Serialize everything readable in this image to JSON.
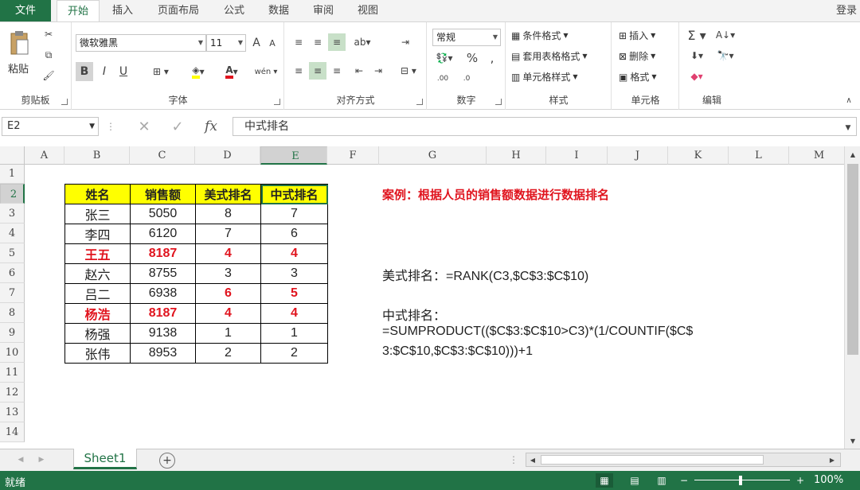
{
  "tabs": {
    "file": "文件",
    "home": "开始",
    "insert": "插入",
    "layout": "页面布局",
    "formulas": "公式",
    "data": "数据",
    "review": "审阅",
    "view": "视图",
    "login": "登录"
  },
  "ribbon": {
    "clipboard": {
      "paste": "粘贴",
      "label": "剪贴板"
    },
    "font": {
      "name": "微软雅黑",
      "size": "11",
      "bold": "B",
      "italic": "I",
      "underline": "U",
      "label": "字体"
    },
    "align": {
      "label": "对齐方式"
    },
    "number": {
      "format": "常规",
      "label": "数字"
    },
    "styles": {
      "cond": "条件格式",
      "table": "套用表格格式",
      "cell": "单元格样式",
      "label": "样式"
    },
    "cells": {
      "insert": "插入",
      "delete": "删除",
      "format": "格式",
      "label": "单元格"
    },
    "edit": {
      "label": "编辑"
    }
  },
  "formula_bar": {
    "name_box": "E2",
    "fx": "fx",
    "content": "中式排名"
  },
  "columns": [
    "A",
    "B",
    "C",
    "D",
    "E",
    "F",
    "G",
    "H",
    "I",
    "J",
    "K",
    "L",
    "M"
  ],
  "rows": [
    "1",
    "2",
    "3",
    "4",
    "5",
    "6",
    "7",
    "8",
    "9",
    "10",
    "11",
    "12",
    "13",
    "14"
  ],
  "table": {
    "headers": [
      "姓名",
      "销售额",
      "美式排名",
      "中式排名"
    ],
    "rows": [
      {
        "name": "张三",
        "sales": "5050",
        "us": "8",
        "cn": "7"
      },
      {
        "name": "李四",
        "sales": "6120",
        "us": "7",
        "cn": "6"
      },
      {
        "name": "王五",
        "sales": "8187",
        "us": "4",
        "cn": "4"
      },
      {
        "name": "赵六",
        "sales": "8755",
        "us": "3",
        "cn": "3"
      },
      {
        "name": "吕二",
        "sales": "6938",
        "us": "6",
        "cn": "5"
      },
      {
        "name": "杨浩",
        "sales": "8187",
        "us": "4",
        "cn": "4"
      },
      {
        "name": "杨强",
        "sales": "9138",
        "us": "1",
        "cn": "1"
      },
      {
        "name": "张伟",
        "sales": "8953",
        "us": "2",
        "cn": "2"
      }
    ]
  },
  "notes": {
    "title": "案例：根据人员的销售额数据进行数据排名",
    "us_formula": "美式排名：=RANK(C3,$C$3:$C$10)",
    "cn_label": "中式排名：",
    "cn_formula_1": "=SUMPRODUCT(($C$3:$C$10>C3)*(1/COUNTIF($C$",
    "cn_formula_2": "3:$C$10,$C$3:$C$10)))+1"
  },
  "sheet": {
    "tab": "Sheet1"
  },
  "status": {
    "ready": "就绪",
    "zoom": "100%"
  },
  "colors": {
    "accent": "#217346",
    "highlight": "#ffff00",
    "red": "#e0141e"
  }
}
